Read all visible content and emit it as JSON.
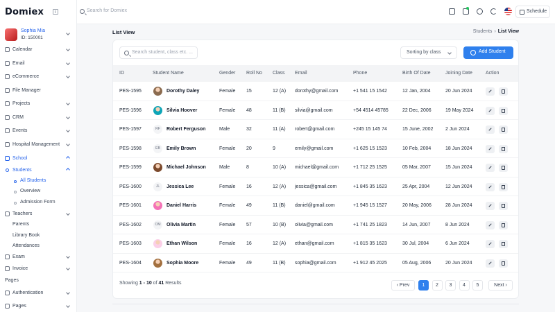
{
  "brand": {
    "logo": "Domiex"
  },
  "user": {
    "name": "Sophia Mia",
    "id": "ID: 150001"
  },
  "sidebar": {
    "items": [
      {
        "label": "Calendar",
        "chevron": true
      },
      {
        "label": "Email",
        "chevron": true
      },
      {
        "label": "eCommerce",
        "chevron": true
      },
      {
        "label": "File Manager",
        "chevron": false
      },
      {
        "label": "Projects",
        "chevron": true
      },
      {
        "label": "CRM",
        "chevron": true
      },
      {
        "label": "Events",
        "chevron": true
      },
      {
        "label": "Hospital Management",
        "chevron": true
      },
      {
        "label": "School",
        "chevron": true
      }
    ],
    "students_label": "Students",
    "sub_items": [
      "All Students",
      "Overview",
      "Admission Form"
    ],
    "items2": [
      {
        "label": "Teachers",
        "chevron": true
      },
      {
        "label": "Parents",
        "chevron": false
      },
      {
        "label": "Library Book",
        "chevron": false
      },
      {
        "label": "Attendances",
        "chevron": false
      },
      {
        "label": "Exam",
        "chevron": true
      },
      {
        "label": "Invoice",
        "chevron": true
      }
    ],
    "section_pages": "Pages",
    "items3": [
      {
        "label": "Authentication",
        "chevron": true
      },
      {
        "label": "Pages",
        "chevron": true
      }
    ]
  },
  "topbar": {
    "search_placeholder": "Search for Domiex",
    "schedule_label": "Schedule"
  },
  "page": {
    "title": "List View",
    "breadcrumb_parent": "Students",
    "breadcrumb_current": "List View"
  },
  "toolbar": {
    "search_placeholder": "Search student, class etc. ...",
    "sort_value": "Sorting by class",
    "add_label": "Add Student"
  },
  "table": {
    "columns": [
      "ID",
      "Student Name",
      "Gender",
      "Roll No",
      "Class",
      "Email",
      "Phone",
      "Birth Of Date",
      "Joining Date",
      "Action"
    ],
    "rows": [
      {
        "id": "PES-1595",
        "name": "Dorothy Daley",
        "gender": "Female",
        "roll": "15",
        "class": "12 (A)",
        "email": "dorothy@gmail.com",
        "phone": "+1 541 15 1542",
        "birth": "12 Jan, 2004",
        "join": "20 Jun 2024",
        "avatar": "photo",
        "initials": "",
        "avatar_color": "#8b6b4f"
      },
      {
        "id": "PES-1596",
        "name": "Silvia Hoover",
        "gender": "Female",
        "roll": "48",
        "class": "11 (B)",
        "email": "silvia@gmail.com",
        "phone": "+54 4514 45785",
        "birth": "22 Dec, 2006",
        "join": "19 May 2024",
        "avatar": "photo",
        "initials": "",
        "avatar_color": "#0ea5b7"
      },
      {
        "id": "PES-1597",
        "name": "Robert Ferguson",
        "gender": "Male",
        "roll": "32",
        "class": "11 (A)",
        "email": "robert@gmail.com",
        "phone": "+245 15 145 74",
        "birth": "15 June, 2002",
        "join": "2 Jun 2024",
        "avatar": "initials",
        "initials": "RF",
        "avatar_color": "#f3f4f6"
      },
      {
        "id": "PES-1598",
        "name": "Emily Brown",
        "gender": "Female",
        "roll": "20",
        "class": "9",
        "email": "emily@gmail.com",
        "phone": "+1 625 15 1523",
        "birth": "10 Feb, 2004",
        "join": "18 Jun 2024",
        "avatar": "initials",
        "initials": "EB",
        "avatar_color": "#f3f4f6"
      },
      {
        "id": "PES-1599",
        "name": "Michael Johnson",
        "gender": "Male",
        "roll": "8",
        "class": "10 (A)",
        "email": "michael@gmail.com",
        "phone": "+1 712 25 1525",
        "birth": "05 Mar, 2007",
        "join": "15 Jun 2024",
        "avatar": "photo",
        "initials": "",
        "avatar_color": "#7c4a2d"
      },
      {
        "id": "PES-1600",
        "name": "Jessica Lee",
        "gender": "Female",
        "roll": "16",
        "class": "12 (A)",
        "email": "jessica@gmail.com",
        "phone": "+1 845 35 1623",
        "birth": "25 Apr, 2004",
        "join": "12 Jun 2024",
        "avatar": "initials",
        "initials": "JL",
        "avatar_color": "#f3f4f6"
      },
      {
        "id": "PES-1601",
        "name": "Daniel Harris",
        "gender": "Female",
        "roll": "49",
        "class": "11 (B)",
        "email": "daniel@gmail.com",
        "phone": "+1 945 15 1527",
        "birth": "20 May, 2006",
        "join": "28 Jun 2024",
        "avatar": "photo",
        "initials": "",
        "avatar_color": "#f472b6"
      },
      {
        "id": "PES-1602",
        "name": "Olivia Martin",
        "gender": "Female",
        "roll": "57",
        "class": "10 (B)",
        "email": "olivia@gmail.com",
        "phone": "+1 741 25 1823",
        "birth": "14 Jun, 2007",
        "join": "8 Jun 2024",
        "avatar": "initials",
        "initials": "OM",
        "avatar_color": "#f3f4f6"
      },
      {
        "id": "PES-1603",
        "name": "Ethan Wilson",
        "gender": "Female",
        "roll": "16",
        "class": "12 (A)",
        "email": "ethan@gmail.com",
        "phone": "+1 815 35 1623",
        "birth": "30 Jul, 2004",
        "join": "6 Jun 2024",
        "avatar": "photo",
        "initials": "",
        "avatar_color": "#fbcfe8"
      },
      {
        "id": "PES-1604",
        "name": "Sophia Moore",
        "gender": "Female",
        "roll": "49",
        "class": "11 (B)",
        "email": "sophia@gmail.com",
        "phone": "+1 912 45 2025",
        "birth": "05 Aug, 2006",
        "join": "20 Jun 2024",
        "avatar": "photo",
        "initials": "",
        "avatar_color": "#a3703f"
      }
    ]
  },
  "footer_info": {
    "showing_prefix": "Showing ",
    "from": "1",
    "dash": " - ",
    "to": "10",
    "of": " of ",
    "total": "41",
    "suffix": " Results"
  },
  "pagination": {
    "prev": "‹ Prev",
    "pages": [
      "1",
      "2",
      "3",
      "4",
      "5"
    ],
    "active": "1",
    "next": "Next ›"
  },
  "colors": {
    "accent": "#2f80ed",
    "active_nav": "#2563eb"
  },
  "icons": [
    "search-icon",
    "grid-icon",
    "bell-icon",
    "gear-icon",
    "moon-icon",
    "calendar-icon",
    "plus-icon",
    "pencil-icon",
    "trash-icon"
  ]
}
